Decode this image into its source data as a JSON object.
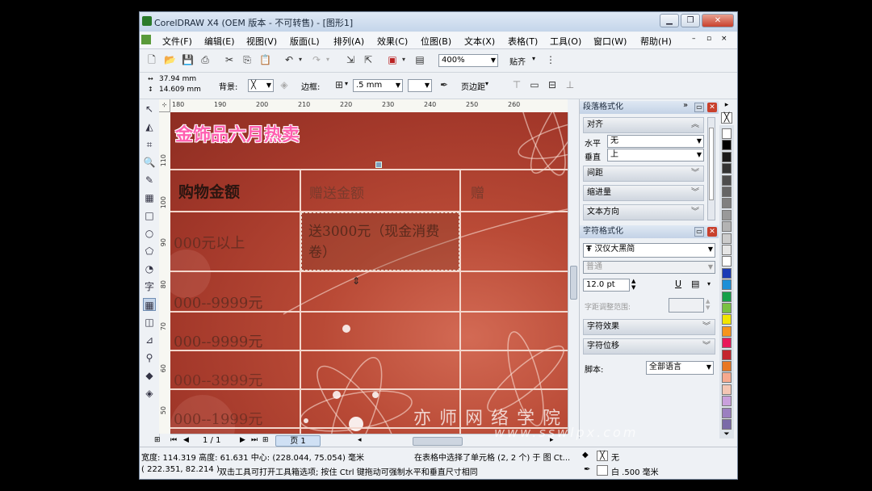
{
  "window": {
    "title": "CorelDRAW X4 (OEM 版本 - 不可转售) - [图形1]"
  },
  "menu": [
    "文件(F)",
    "编辑(E)",
    "视图(V)",
    "版面(L)",
    "排列(A)",
    "效果(C)",
    "位图(B)",
    "文本(X)",
    "表格(T)",
    "工具(O)",
    "窗口(W)",
    "帮助(H)"
  ],
  "toolbar": {
    "zoom": "400%",
    "snap_label": "贴齐"
  },
  "property_bar": {
    "width": "37.94 mm",
    "height": "14.609 mm",
    "background_label": "背景:",
    "border_label": "边框:",
    "border_width": ".5 mm",
    "margin_label": "页边距"
  },
  "ruler_h": [
    "180",
    "190",
    "200",
    "210",
    "220",
    "230",
    "240",
    "250",
    "260"
  ],
  "ruler_v": [
    "110",
    "100",
    "90",
    "80",
    "70",
    "60",
    "50"
  ],
  "canvas": {
    "heading": "金饰品六月热卖",
    "header_cells": [
      "购物金额",
      "赠送金额",
      "赠"
    ],
    "row_cells": [
      "000元以上",
      "000--9999元",
      "000--9999元",
      "000--3999元",
      "000--1999元"
    ],
    "selected_cell": "送3000元（现金消费卷）"
  },
  "page_nav": {
    "page_count": "1 / 1",
    "page_tab": "页 1"
  },
  "docker": {
    "para_title": "段落格式化",
    "align_label": "对齐",
    "horizontal_label": "水平",
    "horizontal_value": "无",
    "vertical_label": "垂直",
    "vertical_value": "上",
    "spacing_label": "间距",
    "indent_label": "缩进量",
    "direction_label": "文本方向",
    "char_title": "字符格式化",
    "font_name": "汉仪大黑简",
    "font_style": "普通",
    "font_size": "12.0 pt",
    "kerning_label": "字距调整范围:",
    "effects_label": "字符效果",
    "shift_label": "字符位移",
    "script_label": "脚本:",
    "script_value": "全部语言"
  },
  "status": {
    "dims": "宽度: 114.319 高度: 61.631 中心: (228.044, 75.054) 毫米",
    "message": "在表格中选择了单元格 (2, 2 个) 于 图 Ct...",
    "coords": "( 222.351, 82.214 )",
    "hint": "双击工具可打开工具箱选项; 按住 Ctrl 键拖动可强制水平和垂直尺寸相同",
    "fill_label": "无",
    "outline_label": "白 .500 毫米"
  },
  "watermark": {
    "text": "亦师网络学院",
    "url": "www.sswlpx.com"
  },
  "palette": [
    "#ffffff",
    "#000000",
    "#1a1a1a",
    "#333333",
    "#4d4d4d",
    "#666666",
    "#808080",
    "#999999",
    "#b3b3b3",
    "#cccccc",
    "#e6e6e6",
    "#ffffff",
    "#1a3ab5",
    "#1d8fd6",
    "#15a04a",
    "#7ac142",
    "#f2e500",
    "#f7941d",
    "#e8185a",
    "#c4262e",
    "#e87722",
    "#f6a98e",
    "#f4c6b4",
    "#c9a0dc",
    "#9b7fc0",
    "#7a6aa8"
  ]
}
